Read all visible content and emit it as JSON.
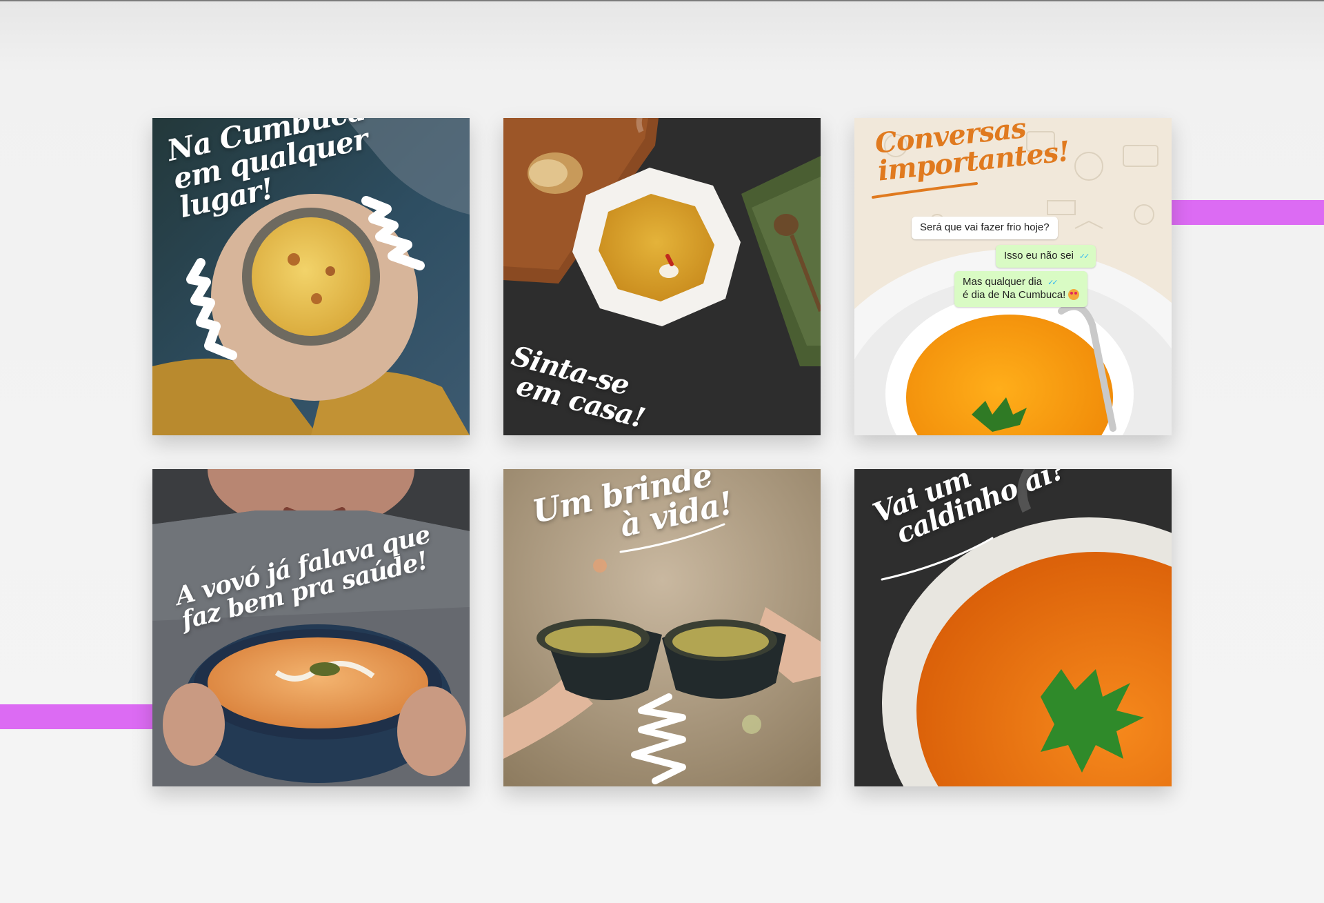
{
  "posts": [
    {
      "lines": [
        "Na Cumbuca",
        "em qualquer",
        "lugar!"
      ]
    },
    {
      "lines": [
        "Sinta-se",
        "em casa!"
      ]
    },
    {
      "title_lines": [
        "Conversas",
        "importantes!"
      ],
      "chat": [
        {
          "text": "Será que vai fazer frio hoje?"
        },
        {
          "text": "Isso eu não sei"
        },
        {
          "text": "Mas qualquer dia",
          "text2": "é dia de Na Cumbuca!"
        }
      ]
    },
    {
      "lines": [
        "A vovó já falava que",
        "faz bem pra saúde!"
      ]
    },
    {
      "lines": [
        "Um brinde",
        "à vida!"
      ]
    },
    {
      "lines": [
        "Vai um",
        "caldinho aí?"
      ]
    }
  ],
  "colors": {
    "accent_stripe": "#dc6bf3",
    "title_orange": "#e07a1f",
    "chat_out": "#d9fbc4"
  },
  "icons": [
    "double-check-icon",
    "heart-eyes-emoji-icon"
  ]
}
